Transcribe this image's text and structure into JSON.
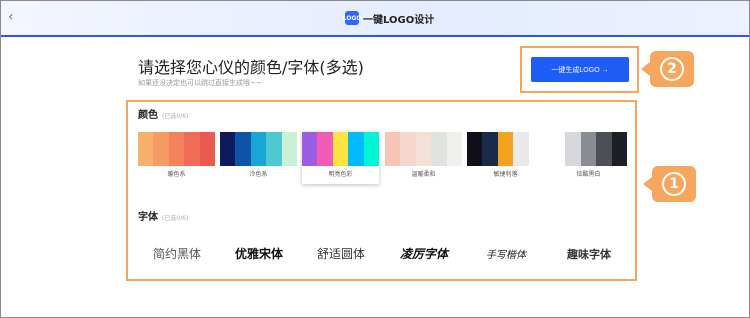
{
  "app": {
    "title": "一键LOGO设计",
    "logo_badge": "LOGO"
  },
  "nav": {
    "back_glyph": "‹"
  },
  "heading": {
    "title": "请选择您心仪的颜色/字体(多选)",
    "subtitle": "如果还没决定也可以跳过直接生成哦~~"
  },
  "generate_button": {
    "label": "一键生成LOGO →"
  },
  "markers": {
    "one": "1",
    "two": "2"
  },
  "colors": {
    "title": "颜色",
    "hint": "(已选0/6)",
    "items": [
      {
        "label": "暖色系",
        "swatches": [
          "#f8b06c",
          "#f79a63",
          "#f4835c",
          "#f06e57",
          "#ea5a50"
        ],
        "selected": false
      },
      {
        "label": "冷色系",
        "swatches": [
          "#0d1a5e",
          "#0b54a8",
          "#19a6d4",
          "#4ec9d3",
          "#c8f1d6"
        ],
        "selected": false
      },
      {
        "label": "明亮色彩",
        "swatches": [
          "#9b5de5",
          "#f15bb5",
          "#fee440",
          "#00bbf9",
          "#00f5d4"
        ],
        "selected": true
      },
      {
        "label": "温暖柔和",
        "swatches": [
          "#f9c4b8",
          "#f7d6cc",
          "#f3e1d8",
          "#dfe3dd",
          "#eef0ec"
        ],
        "selected": false
      },
      {
        "label": "敏捷利落",
        "swatches": [
          "#0f0f1a",
          "#1c2a4a",
          "#f3a31b",
          "#e9e9e9",
          "#ffffff"
        ],
        "selected": false
      },
      {
        "label": "炫酷黑白",
        "swatches": [
          "#ffffff",
          "#d6d8db",
          "#8a8d93",
          "#4c4f56",
          "#1e1f24"
        ],
        "selected": false
      }
    ]
  },
  "fonts": {
    "title": "字体",
    "hint": "(已选0/6)",
    "items": [
      {
        "label": "简约黑体"
      },
      {
        "label": "优雅宋体"
      },
      {
        "label": "舒适圆体"
      },
      {
        "label": "凌厉字体"
      },
      {
        "label": "手写楷体"
      },
      {
        "label": "趣味字体"
      }
    ]
  }
}
